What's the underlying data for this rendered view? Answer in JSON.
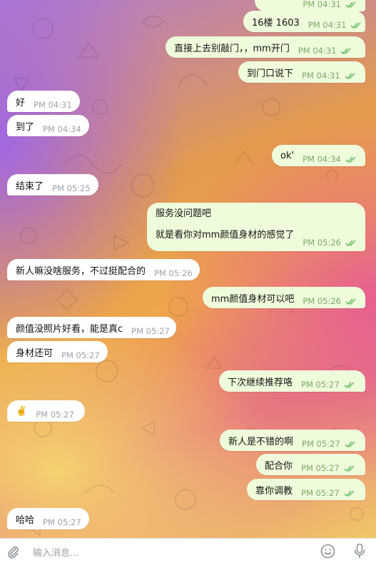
{
  "messages": [
    {
      "dir": "out",
      "text": "",
      "time": "PM 04:31"
    },
    {
      "dir": "out",
      "text": "16楼 1603",
      "time": "PM 04:31"
    },
    {
      "dir": "out",
      "text": "直接上去别敲门，，mm开门",
      "time": "PM 04:31"
    },
    {
      "dir": "out",
      "text": "到门口说下",
      "time": "PM 04:31"
    },
    {
      "dir": "in",
      "text": "好",
      "time": "PM 04:31"
    },
    {
      "dir": "in",
      "text": "到了",
      "time": "PM 04:34"
    },
    {
      "dir": "out",
      "text": "ok'",
      "time": "PM 04:34"
    },
    {
      "dir": "in",
      "text": "结束了",
      "time": "PM 05:25"
    },
    {
      "dir": "out",
      "text": "服务没问题吧",
      "text2": "就是看你对mm颜值身材的感觉了",
      "time": "PM 05:26"
    },
    {
      "dir": "in",
      "text": "新人嘛没啥服务，不过挺配合的",
      "time": "PM 05:26"
    },
    {
      "dir": "out",
      "text": "mm颜值身材可以吧",
      "time": "PM 05:26"
    },
    {
      "dir": "in",
      "text": "颜值没照片好看，能是真c",
      "time": "PM 05:27"
    },
    {
      "dir": "in",
      "text": "身材还可",
      "time": "PM 05:27"
    },
    {
      "dir": "out",
      "text": "下次继续推荐咯",
      "time": "PM 05:27"
    },
    {
      "dir": "in",
      "text": "✌️",
      "time": "PM 05:27"
    },
    {
      "dir": "out",
      "text": "新人是不错的啊",
      "time": "PM 05:27"
    },
    {
      "dir": "out",
      "text": "配合你",
      "time": "PM 05:27"
    },
    {
      "dir": "out",
      "text": "靠你调教",
      "time": "PM 05:27"
    },
    {
      "dir": "in",
      "text": "哈哈",
      "time": "PM 05:27"
    }
  ],
  "input": {
    "placeholder": "输入消息..."
  },
  "icons": {
    "attach": "paperclip-icon",
    "emoji": "smiley-icon",
    "mic": "microphone-icon",
    "read": "double-check-icon"
  },
  "colors": {
    "outgoing_bubble": "#effcdc",
    "incoming_bubble": "#ffffff",
    "tick": "#5fb85a"
  }
}
